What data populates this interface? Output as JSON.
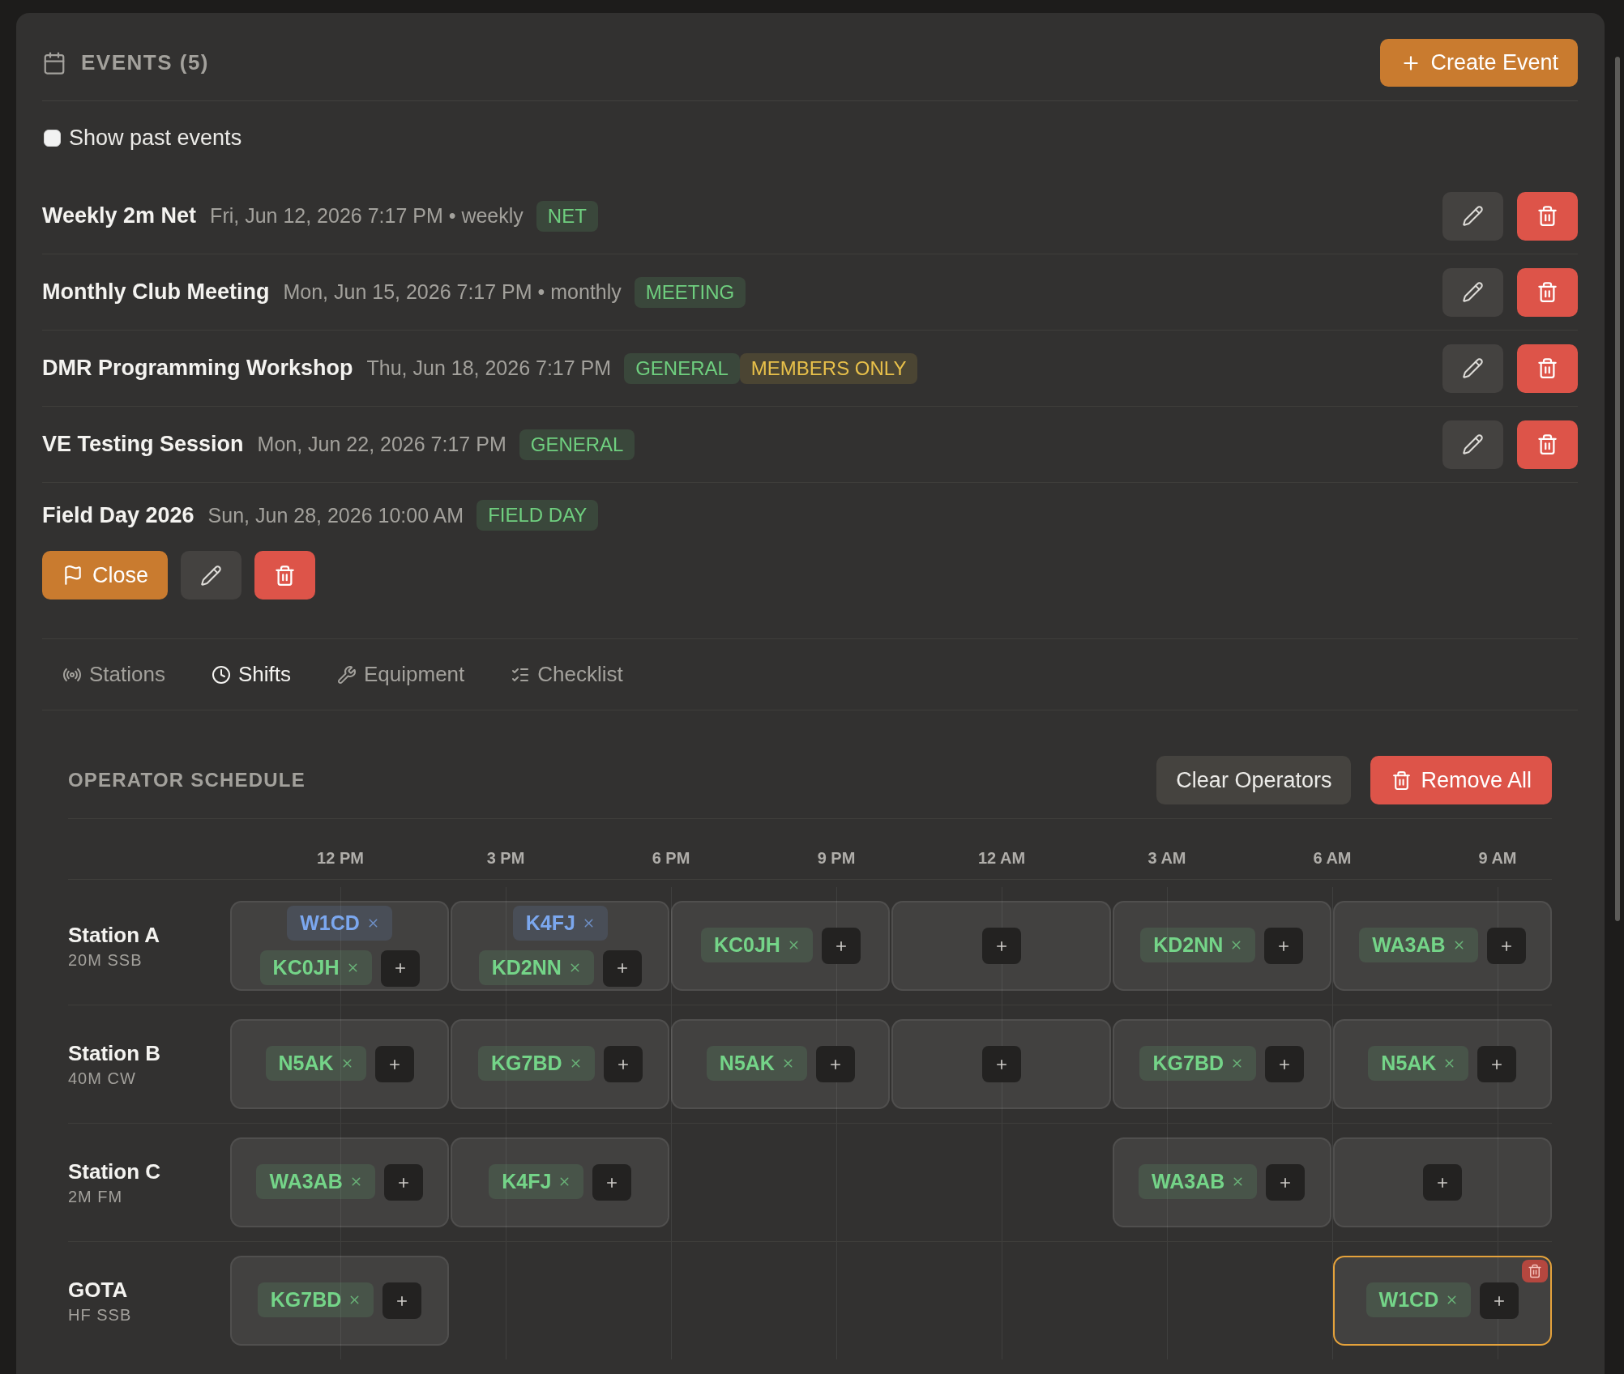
{
  "header": {
    "title": "EVENTS (5)",
    "create_button": "Create Event"
  },
  "show_past": {
    "label": "Show past events",
    "checked": false
  },
  "events": [
    {
      "title": "Weekly 2m Net",
      "when": "Fri, Jun 12, 2026 7:17 PM • weekly",
      "tags": [
        {
          "label": "NET",
          "color": "#6fcf7f"
        }
      ],
      "expanded": false
    },
    {
      "title": "Monthly Club Meeting",
      "when": "Mon, Jun 15, 2026 7:17 PM • monthly",
      "tags": [
        {
          "label": "MEETING",
          "color": "#6fcf7f"
        }
      ],
      "expanded": false
    },
    {
      "title": "DMR Programming Workshop",
      "when": "Thu, Jun 18, 2026 7:17 PM",
      "tags": [
        {
          "label": "GENERAL",
          "color": "#6fcf7f"
        },
        {
          "label": "MEMBERS ONLY",
          "color": "#e8c04a"
        }
      ],
      "expanded": false
    },
    {
      "title": "VE Testing Session",
      "when": "Mon, Jun 22, 2026 7:17 PM",
      "tags": [
        {
          "label": "GENERAL",
          "color": "#6fcf7f"
        }
      ],
      "expanded": false
    },
    {
      "title": "Field Day 2026",
      "when": "Sun, Jun 28, 2026 10:00 AM",
      "tags": [
        {
          "label": "FIELD DAY",
          "color": "#6fcf7f"
        }
      ],
      "expanded": true,
      "close_button": "Close"
    }
  ],
  "tabs": [
    {
      "label": "Stations",
      "selected": false
    },
    {
      "label": "Shifts",
      "selected": true
    },
    {
      "label": "Equipment",
      "selected": false
    },
    {
      "label": "Checklist",
      "selected": false
    }
  ],
  "schedule": {
    "title": "OPERATOR SCHEDULE",
    "clear_button": "Clear Operators",
    "remove_all_button": "Remove All",
    "times": [
      "12 PM",
      "3 PM",
      "6 PM",
      "9 PM",
      "12 AM",
      "3 AM",
      "6 AM",
      "9 AM"
    ],
    "stations": [
      {
        "name": "Station A",
        "band": "20M SSB",
        "slots": [
          {
            "kind": "shift",
            "selected": false,
            "operators": [
              {
                "call": "W1CD",
                "color": "#7ba7ee"
              },
              {
                "call": "KC0JH",
                "color": "#74d488"
              }
            ]
          },
          {
            "kind": "shift",
            "selected": false,
            "operators": [
              {
                "call": "K4FJ",
                "color": "#7ba7ee"
              },
              {
                "call": "KD2NN",
                "color": "#74d488"
              }
            ]
          },
          {
            "kind": "shift",
            "selected": false,
            "operators": [
              {
                "call": "KC0JH",
                "color": "#74d488"
              }
            ]
          },
          {
            "kind": "shift",
            "selected": false
          },
          {
            "kind": "shift",
            "selected": false,
            "operators": [
              {
                "call": "KD2NN",
                "color": "#74d488"
              }
            ]
          },
          {
            "kind": "shift",
            "selected": false,
            "operators": [
              {
                "call": "WA3AB",
                "color": "#74d488"
              }
            ]
          }
        ]
      },
      {
        "name": "Station B",
        "band": "40M CW",
        "slots": [
          {
            "kind": "shift",
            "selected": false,
            "operators": [
              {
                "call": "N5AK",
                "color": "#74d488"
              }
            ]
          },
          {
            "kind": "shift",
            "selected": false,
            "operators": [
              {
                "call": "KG7BD",
                "color": "#74d488"
              }
            ]
          },
          {
            "kind": "shift",
            "selected": false,
            "operators": [
              {
                "call": "N5AK",
                "color": "#74d488"
              }
            ]
          },
          {
            "kind": "shift",
            "selected": false
          },
          {
            "kind": "shift",
            "selected": false,
            "operators": [
              {
                "call": "KG7BD",
                "color": "#74d488"
              }
            ]
          },
          {
            "kind": "shift",
            "selected": false,
            "operators": [
              {
                "call": "N5AK",
                "color": "#74d488"
              }
            ]
          }
        ]
      },
      {
        "name": "Station C",
        "band": "2M FM",
        "slots": [
          {
            "kind": "shift",
            "selected": false,
            "operators": [
              {
                "call": "WA3AB",
                "color": "#74d488"
              }
            ]
          },
          {
            "kind": "shift",
            "selected": false,
            "operators": [
              {
                "call": "K4FJ",
                "color": "#74d488"
              }
            ]
          },
          {
            "kind": "open"
          },
          {
            "kind": "open"
          },
          {
            "kind": "shift",
            "selected": false,
            "operators": [
              {
                "call": "WA3AB",
                "color": "#74d488"
              }
            ]
          },
          {
            "kind": "shift",
            "selected": false
          }
        ]
      },
      {
        "name": "GOTA",
        "band": "HF SSB",
        "slots": [
          {
            "kind": "shift",
            "selected": false,
            "operators": [
              {
                "call": "KG7BD",
                "color": "#74d488"
              }
            ]
          },
          {
            "kind": "open"
          },
          {
            "kind": "open"
          },
          {
            "kind": "open"
          },
          {
            "kind": "open"
          },
          {
            "kind": "shift",
            "selected": true,
            "operators": [
              {
                "call": "W1CD",
                "color": "#74d488"
              }
            ]
          }
        ]
      }
    ]
  }
}
